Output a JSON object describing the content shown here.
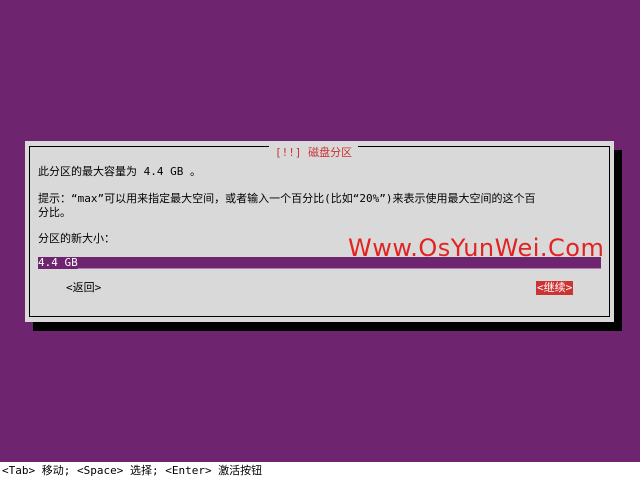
{
  "dialog": {
    "title": "[!!] 磁盘分区",
    "line1": "此分区的最大容量为 4.4 GB 。",
    "hint_line1": "提示：“max”可以用来指定最大空间，或者输入一个百分比(比如“20%”)来表示使用最大空间的这个百",
    "hint_line2": "分比。",
    "prompt": "分区的新大小：",
    "input_value": "4.4 GB"
  },
  "buttons": {
    "back": "<返回>",
    "continue": "<继续>"
  },
  "status_bar": "<Tab> 移动; <Space> 选择; <Enter> 激活按钮",
  "watermark": "Www.OsYunWei.Com",
  "colors": {
    "background": "#6f246f",
    "dialog": "#d9d9d9",
    "title": "#cc3333",
    "selected_button": "#cc3333",
    "watermark": "#e32222"
  }
}
